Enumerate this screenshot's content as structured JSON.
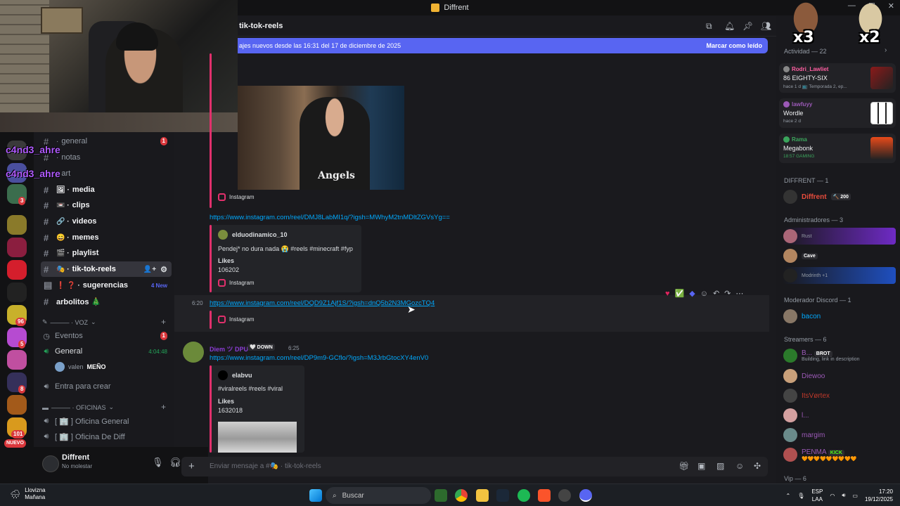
{
  "window": {
    "title": "Diffrent"
  },
  "rail": {
    "badges": [
      "1",
      "3",
      "96",
      "5",
      "8",
      "101"
    ],
    "new_label": "NUEVO"
  },
  "channels": {
    "items": [
      {
        "name": "general",
        "emoji": "·",
        "badge": "1"
      },
      {
        "name": "notas",
        "emoji": "·"
      },
      {
        "name": "art",
        "emoji": "·"
      },
      {
        "name": "media",
        "emoji": "🖼 ·"
      },
      {
        "name": "clips",
        "emoji": "📼 ·"
      },
      {
        "name": "videos",
        "emoji": "🔗 ·"
      },
      {
        "name": "memes",
        "emoji": "😄 ·"
      },
      {
        "name": "playlist",
        "emoji": "🎬 ·"
      },
      {
        "name": "tik-tok-reels",
        "emoji": "🎭 ·"
      },
      {
        "name": "sugerencias",
        "emoji": "❗ ❓ ·",
        "new": "4 New"
      },
      {
        "name": "arbolitos 🎄",
        "emoji": ""
      }
    ],
    "voice_category": "——— · VOZ",
    "voice": [
      {
        "name": "Eventos",
        "badge": "1"
      },
      {
        "name": "General",
        "time": "4:04:48"
      }
    ],
    "voice_user": {
      "name": "valen",
      "tag": "MEÑO"
    },
    "create_channel": "Entra para crear",
    "office_category": "——— · OFICINAS",
    "offices": [
      "[ 🏢 ] Oficina General",
      "[ 🏢 ] Oficina De Diff"
    ]
  },
  "user_panel": {
    "name": "Diffrent",
    "status": "No molestar"
  },
  "overlay": {
    "names": [
      "c4nd3_ahre",
      "c4nd3_ahre"
    ]
  },
  "chat": {
    "channel_title": "tik-tok-reels",
    "banner_text": "ajes nuevos desde las 16:31 del 17 de diciembre de 2025",
    "banner_action": "Marcar como leído",
    "messages": {
      "video_caption": "Angels",
      "ig_label": "Instagram",
      "link1": "https://www.instagram.com/reel/DMJ8LabMI1q/?igsh=MWhyM2tnMDltZGVsYg==",
      "embed1_author": "elduodinamico_10",
      "embed1_text": "Pendej* no dura nada 😭 #reels #minecraft #fyp",
      "embed1_likes_label": "Likes",
      "embed1_likes": "106202",
      "time2": "6:20",
      "link2": "https://www.instagram.com/reel/DQD9Z1Ajf1S/?igsh=dnQ5b2N3MGozcTQ4",
      "author3": "Diem ツ DPU",
      "author3_tag": "🤍 DOWN",
      "time3": "6:25",
      "link3": "https://www.instagram.com/reel/DP9m9-GCflo/?igsh=M3JrbGtocXY4enV0",
      "embed3_author": "elabvu",
      "embed3_text": "#viralreels #reels #viral",
      "embed3_likes_label": "Likes",
      "embed3_likes": "1632018"
    },
    "input_placeholder": "Enviar mensaje a #🎭 · tik-tok-reels"
  },
  "members": {
    "activity_header": "Actividad — 22",
    "activities": [
      {
        "user": "Rodri_Lawliet",
        "color": "#ff5fa2",
        "title": "86 EIGHTY-SIX",
        "sub": "hace 1 d   📺 Temporada 2, ep..."
      },
      {
        "user": "lawfuyy",
        "color": "#9b59b6",
        "title": "Wordle",
        "sub": "hace 2 d"
      },
      {
        "user": "Rama",
        "color": "#3ba55c",
        "title": "Megabonk",
        "sub": "18:57  GAMING"
      }
    ],
    "sections": [
      {
        "label": "DIFFRENT — 1",
        "rows": [
          {
            "name": "Diffrent",
            "color": "#e74c3c",
            "extra": "🔨 200"
          }
        ]
      },
      {
        "label": "Administradores — 3",
        "rows": [
          {
            "name": "",
            "color": "#3b7bff",
            "sub": "Rust"
          },
          {
            "name": "",
            "color": "#3b7bff",
            "sub": "Cave"
          },
          {
            "name": "",
            "color": "#3b7bff",
            "sub": "Modrinth +1"
          }
        ]
      },
      {
        "label": "Moderador Discord — 1",
        "rows": [
          {
            "name": "bacon",
            "color": "#00a8fc"
          }
        ]
      },
      {
        "label": "Streamers — 6",
        "rows": [
          {
            "name": "B...",
            "color": "#9b59b6",
            "sub": "Building, link in description",
            "pill": "BROT"
          },
          {
            "name": "Diewoo",
            "color": "#9b59b6"
          },
          {
            "name": "ItsVørtex",
            "color": "#9b59b6"
          },
          {
            "name": "l...",
            "color": "#9b59b6"
          },
          {
            "name": "margim",
            "color": "#9b59b6"
          },
          {
            "name": "PENMA",
            "color": "#9b59b6",
            "pill": "KICK",
            "sub": "🧡🧡🧡🧡🧡🧡🧡🧡🧡"
          }
        ]
      },
      {
        "label": "Vip — 6",
        "rows": []
      }
    ]
  },
  "emotes": [
    "x3",
    "x2"
  ],
  "taskbar": {
    "weather_title": "Llovizna",
    "weather_sub": "Mañana",
    "search": "Buscar",
    "lang": "ESP",
    "lang_sub": "LAA",
    "time": "17:20",
    "date": "19/12/2025"
  }
}
